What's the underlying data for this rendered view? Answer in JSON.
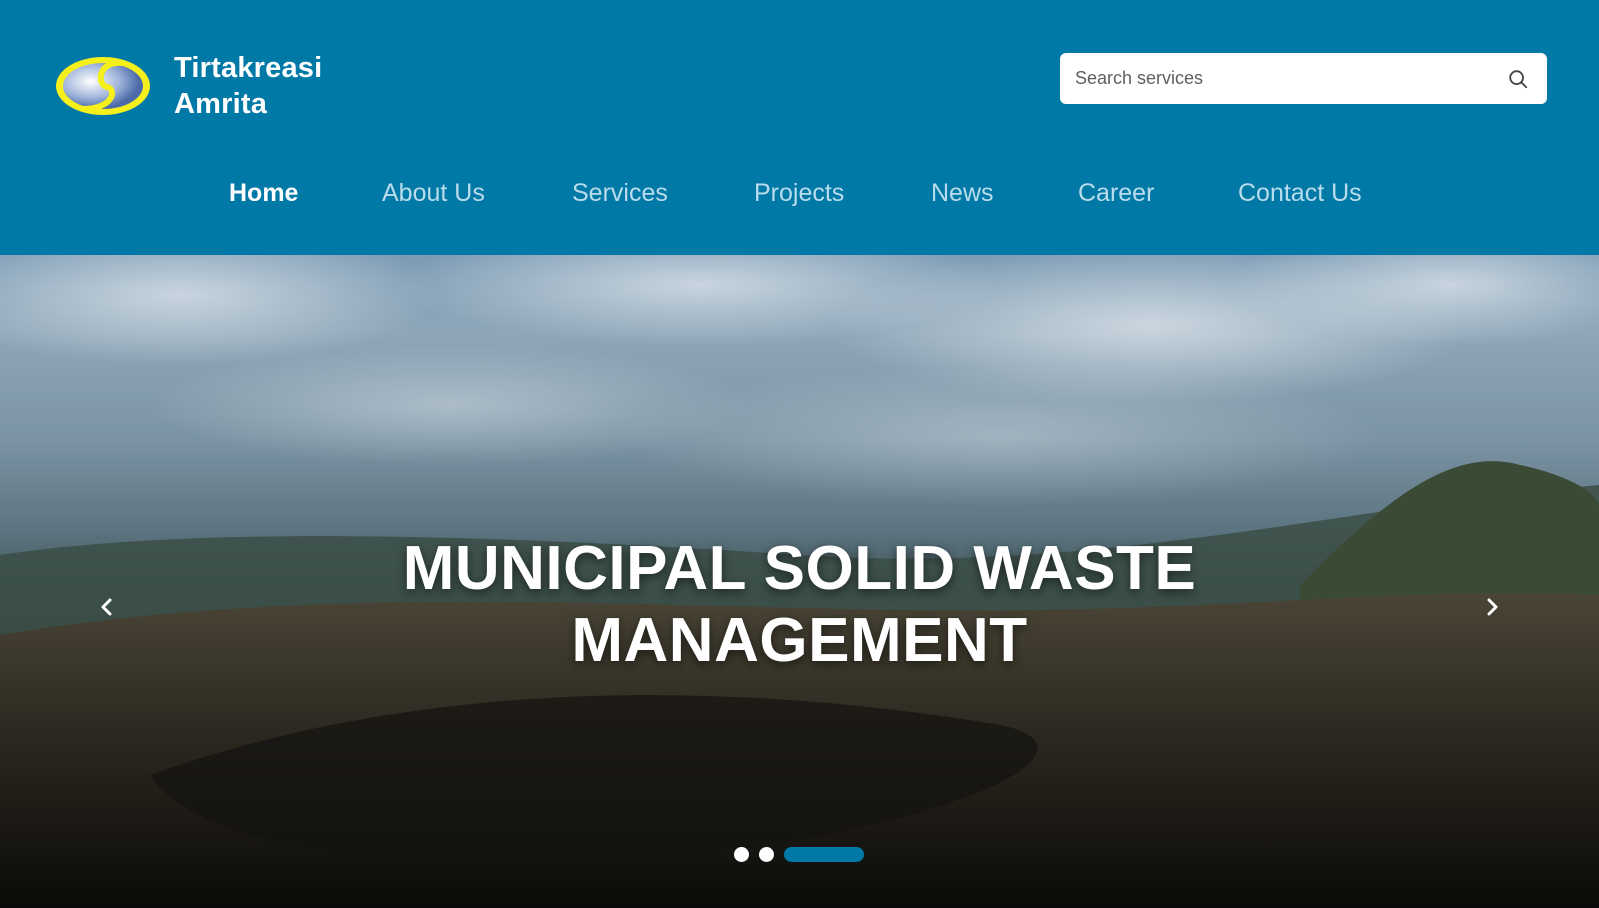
{
  "brand": {
    "line1": "Tirtakreasi",
    "line2": "Amrita",
    "logo_icon": "company-logo-icon"
  },
  "search": {
    "placeholder": "Search services",
    "value": "",
    "icon": "search-icon"
  },
  "nav": {
    "items": [
      {
        "label": "Home",
        "active": true
      },
      {
        "label": "About Us",
        "active": false
      },
      {
        "label": "Services",
        "active": false
      },
      {
        "label": "Projects",
        "active": false
      },
      {
        "label": "News",
        "active": false
      },
      {
        "label": "Career",
        "active": false
      },
      {
        "label": "Contact Us",
        "active": false
      }
    ]
  },
  "hero": {
    "title_line1": "MUNICIPAL SOLID WASTE",
    "title_line2": "MANAGEMENT",
    "prev_icon": "chevron-left-icon",
    "next_icon": "chevron-right-icon",
    "slides_total": 3,
    "active_slide": 3
  },
  "colors": {
    "brand_blue": "#0179a6",
    "nav_inactive": "#b9dcec",
    "logo_yellow": "#f5ef1c"
  }
}
